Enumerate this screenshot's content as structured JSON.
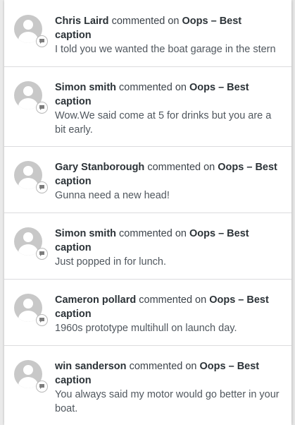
{
  "activity": {
    "verb": "commented on",
    "items": [
      {
        "author": "Chris Laird",
        "post": "Oops – Best caption",
        "comment": "I told you we wanted the boat garage in the stern"
      },
      {
        "author": "Simon smith",
        "post": "Oops – Best caption",
        "comment": "Wow.We said come at 5 for drinks but you are a bit early."
      },
      {
        "author": "Gary Stanborough",
        "post": "Oops – Best caption",
        "comment": "Gunna need a new head!"
      },
      {
        "author": "Simon smith",
        "post": "Oops – Best caption",
        "comment": "Just popped in for lunch."
      },
      {
        "author": "Cameron pollard",
        "post": "Oops – Best caption",
        "comment": "1960s prototype multihull on launch day."
      },
      {
        "author": "win sanderson",
        "post": "Oops – Best caption",
        "comment": "You always said my motor would go better in your boat."
      }
    ]
  },
  "icons": {
    "avatar": "default-avatar-icon",
    "badge": "comment-bubble-icon"
  },
  "colors": {
    "panel": "#ffffff",
    "text": "#3c434a",
    "avatar": "#c8c8c8",
    "divider": "#dcdcde"
  }
}
